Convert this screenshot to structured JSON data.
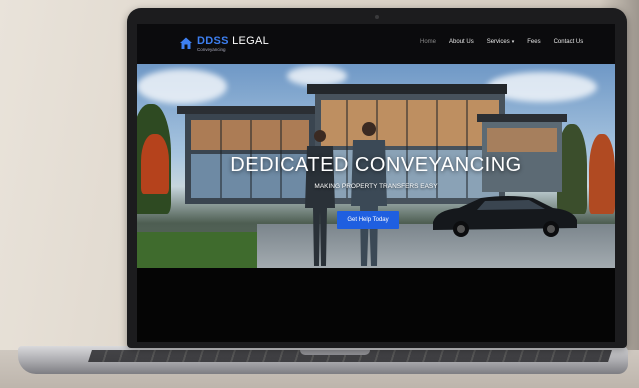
{
  "site": {
    "brand_name_accent": "DDSS",
    "brand_name_rest": " LEGAL",
    "brand_tagline": "Conveyancing"
  },
  "nav": {
    "items": [
      {
        "label": "Home",
        "active": true
      },
      {
        "label": "About Us",
        "active": false
      },
      {
        "label": "Services",
        "active": false,
        "has_dropdown": true
      },
      {
        "label": "Fees",
        "active": false
      },
      {
        "label": "Contact Us",
        "active": false
      }
    ]
  },
  "hero": {
    "title": "DEDICATED CONVEYANCING",
    "subtitle": "MAKING PROPERTY TRANSFERS EASY",
    "cta_label": "Get Help Today"
  },
  "icons": {
    "brand_logo": "house-icon",
    "services_caret": "chevron-down-icon"
  },
  "colors": {
    "accent": "#3d7ff0",
    "cta": "#1f5fe0",
    "nav_bg": "#0b0b0d"
  }
}
